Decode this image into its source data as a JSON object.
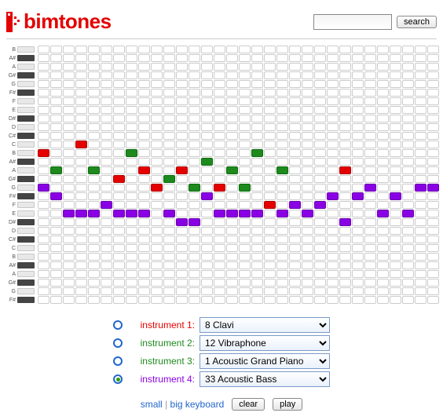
{
  "brand": "bimtones",
  "search": {
    "placeholder": "",
    "value": "",
    "button": "search"
  },
  "row_notes": [
    "B",
    "A#",
    "A",
    "G#",
    "G",
    "F#",
    "F",
    "E",
    "D#",
    "D",
    "C#",
    "C",
    "B",
    "A#",
    "A",
    "G#",
    "G",
    "F#",
    "F",
    "E",
    "D#",
    "D",
    "C#",
    "C",
    "B",
    "A#",
    "A",
    "G#",
    "G",
    "F#"
  ],
  "black_rows": [
    1,
    3,
    5,
    8,
    10,
    13,
    15,
    17,
    20,
    22,
    25,
    27,
    29
  ],
  "cols": 32,
  "chart_data": {
    "type": "sequencer-grid",
    "rows": 30,
    "cols": 32,
    "notes": [
      {
        "r": 11,
        "c": 3,
        "i": 1
      },
      {
        "r": 12,
        "c": 0,
        "i": 1
      },
      {
        "r": 12,
        "c": 7,
        "i": 2
      },
      {
        "r": 12,
        "c": 17,
        "i": 2
      },
      {
        "r": 13,
        "c": 13,
        "i": 2
      },
      {
        "r": 14,
        "c": 1,
        "i": 2
      },
      {
        "r": 14,
        "c": 4,
        "i": 2
      },
      {
        "r": 14,
        "c": 8,
        "i": 1
      },
      {
        "r": 14,
        "c": 11,
        "i": 1
      },
      {
        "r": 14,
        "c": 15,
        "i": 2
      },
      {
        "r": 14,
        "c": 19,
        "i": 2
      },
      {
        "r": 14,
        "c": 24,
        "i": 1
      },
      {
        "r": 15,
        "c": 6,
        "i": 1
      },
      {
        "r": 15,
        "c": 10,
        "i": 2
      },
      {
        "r": 16,
        "c": 0,
        "i": 3
      },
      {
        "r": 16,
        "c": 9,
        "i": 1
      },
      {
        "r": 16,
        "c": 12,
        "i": 2
      },
      {
        "r": 16,
        "c": 14,
        "i": 1
      },
      {
        "r": 16,
        "c": 16,
        "i": 2
      },
      {
        "r": 16,
        "c": 26,
        "i": 3
      },
      {
        "r": 16,
        "c": 30,
        "i": 3
      },
      {
        "r": 16,
        "c": 31,
        "i": 3
      },
      {
        "r": 17,
        "c": 1,
        "i": 3
      },
      {
        "r": 17,
        "c": 13,
        "i": 3
      },
      {
        "r": 17,
        "c": 23,
        "i": 3
      },
      {
        "r": 17,
        "c": 25,
        "i": 3
      },
      {
        "r": 17,
        "c": 28,
        "i": 3
      },
      {
        "r": 18,
        "c": 5,
        "i": 3
      },
      {
        "r": 18,
        "c": 18,
        "i": 1
      },
      {
        "r": 18,
        "c": 20,
        "i": 3
      },
      {
        "r": 18,
        "c": 22,
        "i": 3
      },
      {
        "r": 19,
        "c": 2,
        "i": 3
      },
      {
        "r": 19,
        "c": 3,
        "i": 3
      },
      {
        "r": 19,
        "c": 4,
        "i": 3
      },
      {
        "r": 19,
        "c": 6,
        "i": 3
      },
      {
        "r": 19,
        "c": 7,
        "i": 3
      },
      {
        "r": 19,
        "c": 8,
        "i": 3
      },
      {
        "r": 19,
        "c": 10,
        "i": 3
      },
      {
        "r": 19,
        "c": 14,
        "i": 3
      },
      {
        "r": 19,
        "c": 15,
        "i": 3
      },
      {
        "r": 19,
        "c": 16,
        "i": 3
      },
      {
        "r": 19,
        "c": 17,
        "i": 3
      },
      {
        "r": 19,
        "c": 19,
        "i": 3
      },
      {
        "r": 19,
        "c": 21,
        "i": 3
      },
      {
        "r": 19,
        "c": 27,
        "i": 3
      },
      {
        "r": 19,
        "c": 29,
        "i": 3
      },
      {
        "r": 20,
        "c": 11,
        "i": 3
      },
      {
        "r": 20,
        "c": 12,
        "i": 3
      },
      {
        "r": 20,
        "c": 24,
        "i": 3
      }
    ]
  },
  "instruments": [
    {
      "label": "instrument 1:",
      "color": "#e50000",
      "value": "8 Clavi",
      "selected": false
    },
    {
      "label": "instrument 2:",
      "color": "#1e8a1e",
      "value": "12 Vibraphone",
      "selected": false
    },
    {
      "label": "instrument 3:",
      "color": "#1e8a1e",
      "value": "1 Acoustic Grand Piano",
      "selected": false
    },
    {
      "label": "instrument 4:",
      "color": "#8a00e5",
      "value": "33 Acoustic Bass",
      "selected": true
    }
  ],
  "keyboard_links": {
    "small": "small",
    "sep": "|",
    "big": "big keyboard"
  },
  "buttons": {
    "clear": "clear",
    "play": "play"
  }
}
